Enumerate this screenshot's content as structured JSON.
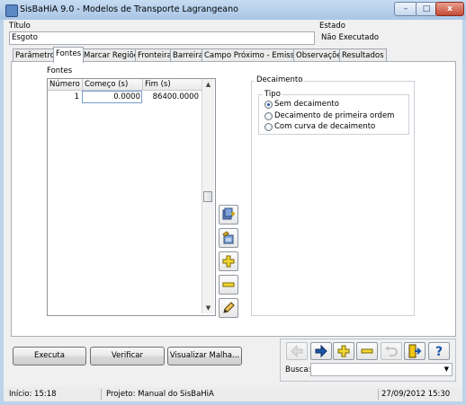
{
  "window": {
    "title": "SisBaHiA 9.0 - Modelos de Transporte Lagrangeano",
    "minimize": "–",
    "maximize": "□",
    "close": "x"
  },
  "header": {
    "titulo_label": "Título",
    "titulo_value": "Esgoto",
    "estado_label": "Estado",
    "estado_value": "Não Executado"
  },
  "tabs": [
    {
      "label": "Parâmetros",
      "active": false
    },
    {
      "label": "Fontes",
      "active": true
    },
    {
      "label": "Marcar Regiões",
      "active": false
    },
    {
      "label": "Fronteira",
      "active": false
    },
    {
      "label": "Barreira",
      "active": false
    },
    {
      "label": "Campo Próximo - Emissários",
      "active": false
    },
    {
      "label": "Observações",
      "active": false
    },
    {
      "label": "Resultados",
      "active": false
    }
  ],
  "fontes": {
    "label": "Fontes",
    "columns": [
      "Número",
      "Começo (s)",
      "Fim (s)"
    ],
    "rows": [
      {
        "numero": "1",
        "comeco": "0.0000",
        "fim": "86400.0000"
      }
    ],
    "buttons": [
      "import-source-icon",
      "edit-source-icon",
      "add-icon",
      "remove-icon",
      "pencil-icon"
    ]
  },
  "decaimento": {
    "label": "Decaimento",
    "tipo_label": "Tipo",
    "options": [
      {
        "label": "Sem decaimento",
        "selected": true
      },
      {
        "label": "Decaimento de primeira ordem",
        "selected": false
      },
      {
        "label": "Com curva de decaimento",
        "selected": false
      }
    ]
  },
  "actions": {
    "executa": "Executa",
    "verificar": "Verificar",
    "visualizar": "Visualizar Malha..."
  },
  "nav": {
    "icons": [
      "back-arrow-icon",
      "forward-arrow-icon",
      "add-icon",
      "remove-icon",
      "undo-icon",
      "exit-icon",
      "help-icon"
    ],
    "busca_label": "Busca:",
    "busca_value": ""
  },
  "status": {
    "inicio": "Início: 15:18",
    "projeto": "Projeto: Manual do SisBaHiA",
    "datetime": "27/09/2012 15:30"
  },
  "colors": {
    "accent_blue": "#1b57a8",
    "add_yellow": "#f3d634",
    "exit_yellow": "#f0c419"
  }
}
